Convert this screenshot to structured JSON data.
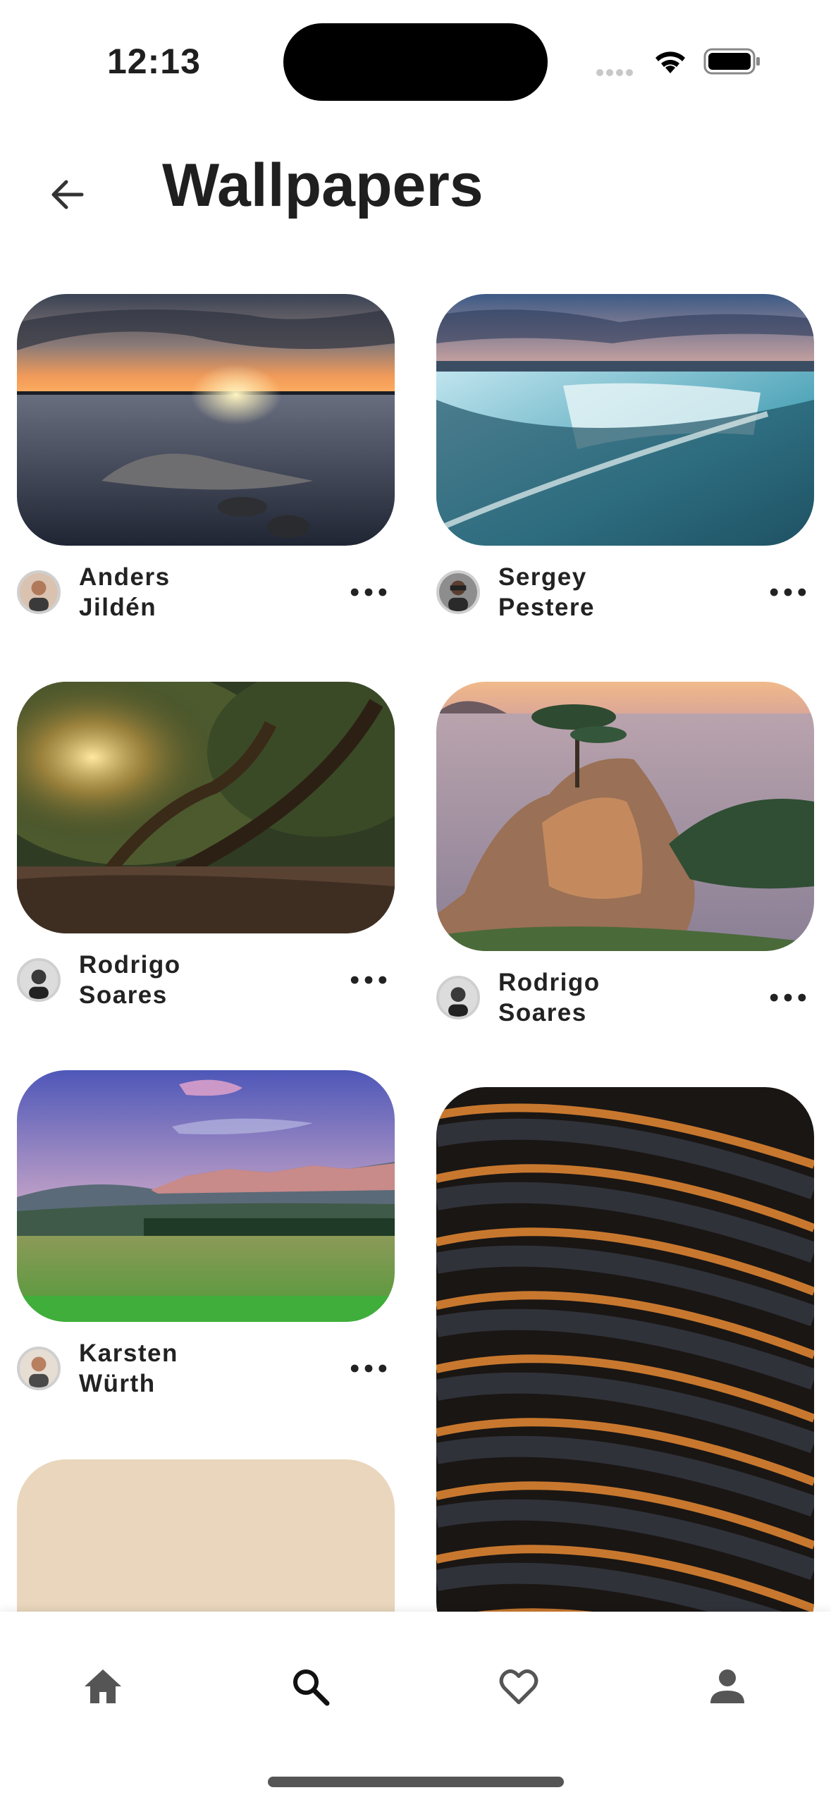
{
  "status_bar": {
    "time": "12:13"
  },
  "header": {
    "title": "Wallpapers"
  },
  "wallpapers": [
    {
      "author": "Anders Jildén",
      "scene": "lake-sunset"
    },
    {
      "author": "Sergey Pestere",
      "scene": "waterfall"
    },
    {
      "author": "Rodrigo Soares",
      "scene": "forest-sunlight"
    },
    {
      "author": "Rodrigo Soares",
      "scene": "cypress-coast"
    },
    {
      "author": "Karsten Würth",
      "scene": "mountain-meadow"
    },
    {
      "author": "",
      "scene": "curved-building"
    },
    {
      "author": "",
      "scene": "beige-texture"
    }
  ],
  "bottom_nav": [
    {
      "icon": "home-icon",
      "active": false
    },
    {
      "icon": "search-icon",
      "active": true
    },
    {
      "icon": "heart-icon",
      "active": false
    },
    {
      "icon": "person-icon",
      "active": false
    }
  ],
  "colors": {
    "text": "#1f1f1f",
    "nav_icon": "#555555",
    "nav_active": "#111111"
  }
}
